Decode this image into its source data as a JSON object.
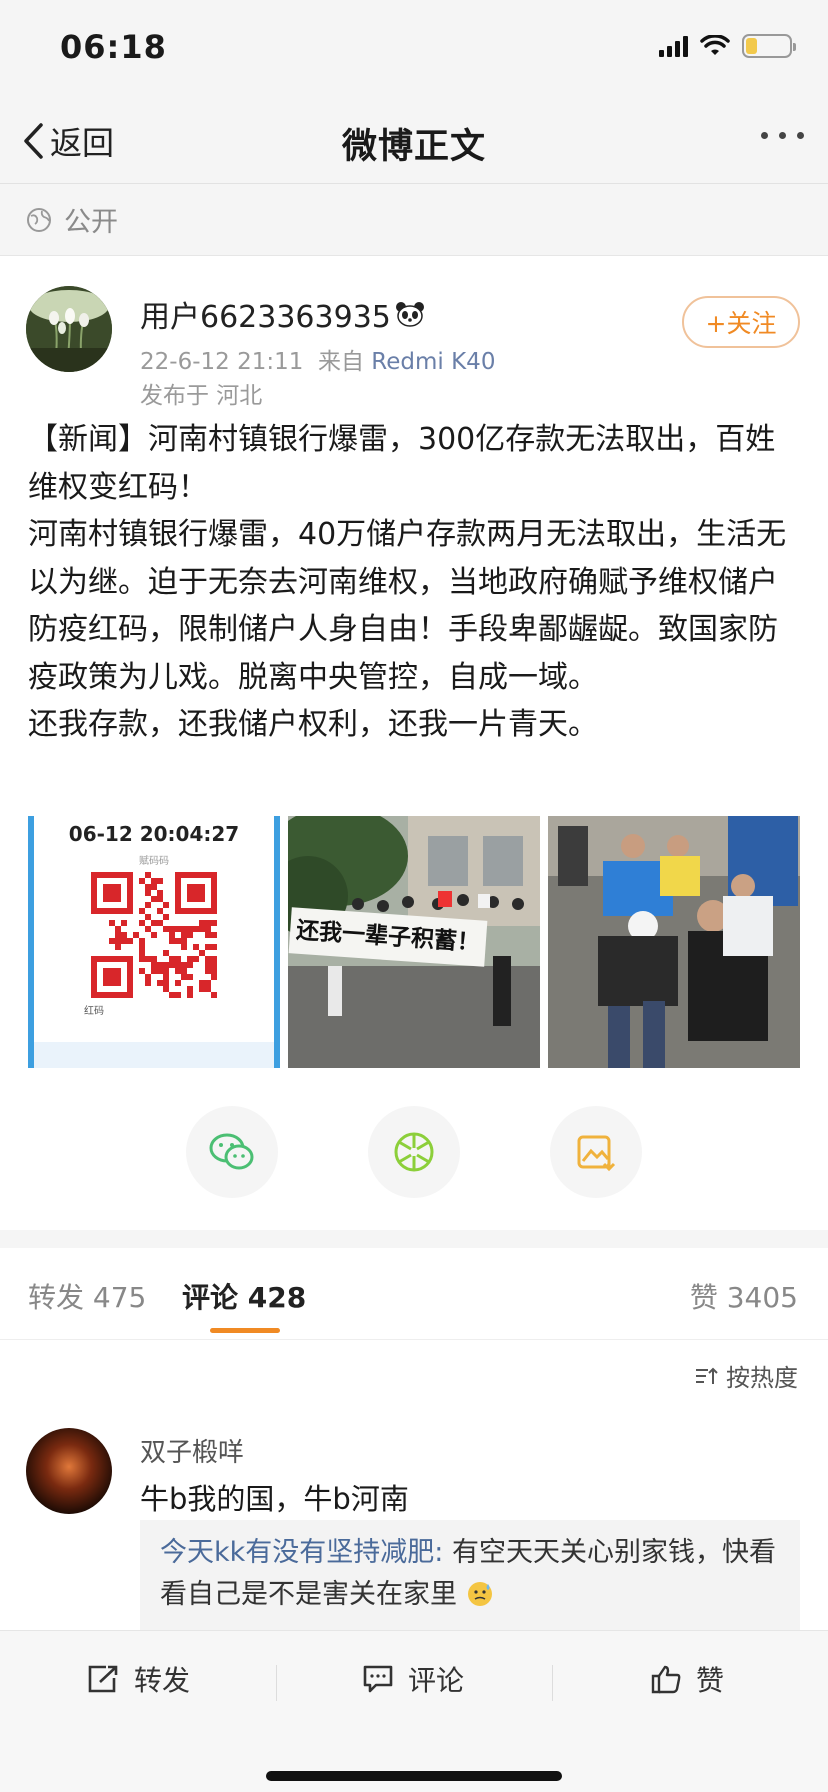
{
  "status_bar": {
    "time": "06:18",
    "battery_level": 0.25,
    "battery_color": "#f2c94c"
  },
  "nav": {
    "back_label": "返回",
    "title": "微博正文"
  },
  "visibility": {
    "label": "公开"
  },
  "post": {
    "username": "用户6623363935",
    "badge_icon": "panda-emoji",
    "time": "22-6-12 21:11",
    "source_prefix": "来自",
    "device": "Redmi K40",
    "location": "发布于 河北",
    "follow_label": "+关注",
    "text_lines": [
      "【新闻】河南村镇银行爆雷，300亿存款无法取出，百姓维权变红码！",
      "河南村镇银行爆雷，40万储户存款两月无法取出，生活无以为继。迫于无奈去河南维权，当地政府确赋予维权储户防疫红码，限制储户人身自由！手段卑鄙龌龊。致国家防疫政策为儿戏。脱离中央管控，自成一域。",
      "还我存款，还我储户权利，还我一片青天。"
    ],
    "images": [
      {
        "type": "health-code",
        "timestamp": "06-12 20:04:27",
        "code_label": "红码",
        "top_label": "赋码码"
      },
      {
        "type": "protest-banner",
        "banner_text": "还我一辈子积蓄！"
      },
      {
        "type": "protest-scuffle"
      }
    ],
    "share_icons": [
      "wechat-icon",
      "moments-icon",
      "save-image-icon"
    ]
  },
  "tabs": {
    "repost": {
      "label": "转发",
      "count": "475"
    },
    "comment": {
      "label": "评论",
      "count": "428"
    },
    "like": {
      "label": "赞",
      "count": "3405"
    },
    "accent": "#f08a24"
  },
  "comments": {
    "sort_label": "按热度",
    "items": [
      {
        "name": "双子椴咩",
        "text": "牛b我的国，牛b河南",
        "reply_name": "今天kk有没有坚持减肥:",
        "reply_text": "有空天天关心别家钱，快看看自己是不是害关在家里"
      }
    ]
  },
  "bottom_bar": {
    "repost": "转发",
    "comment": "评论",
    "like": "赞"
  }
}
